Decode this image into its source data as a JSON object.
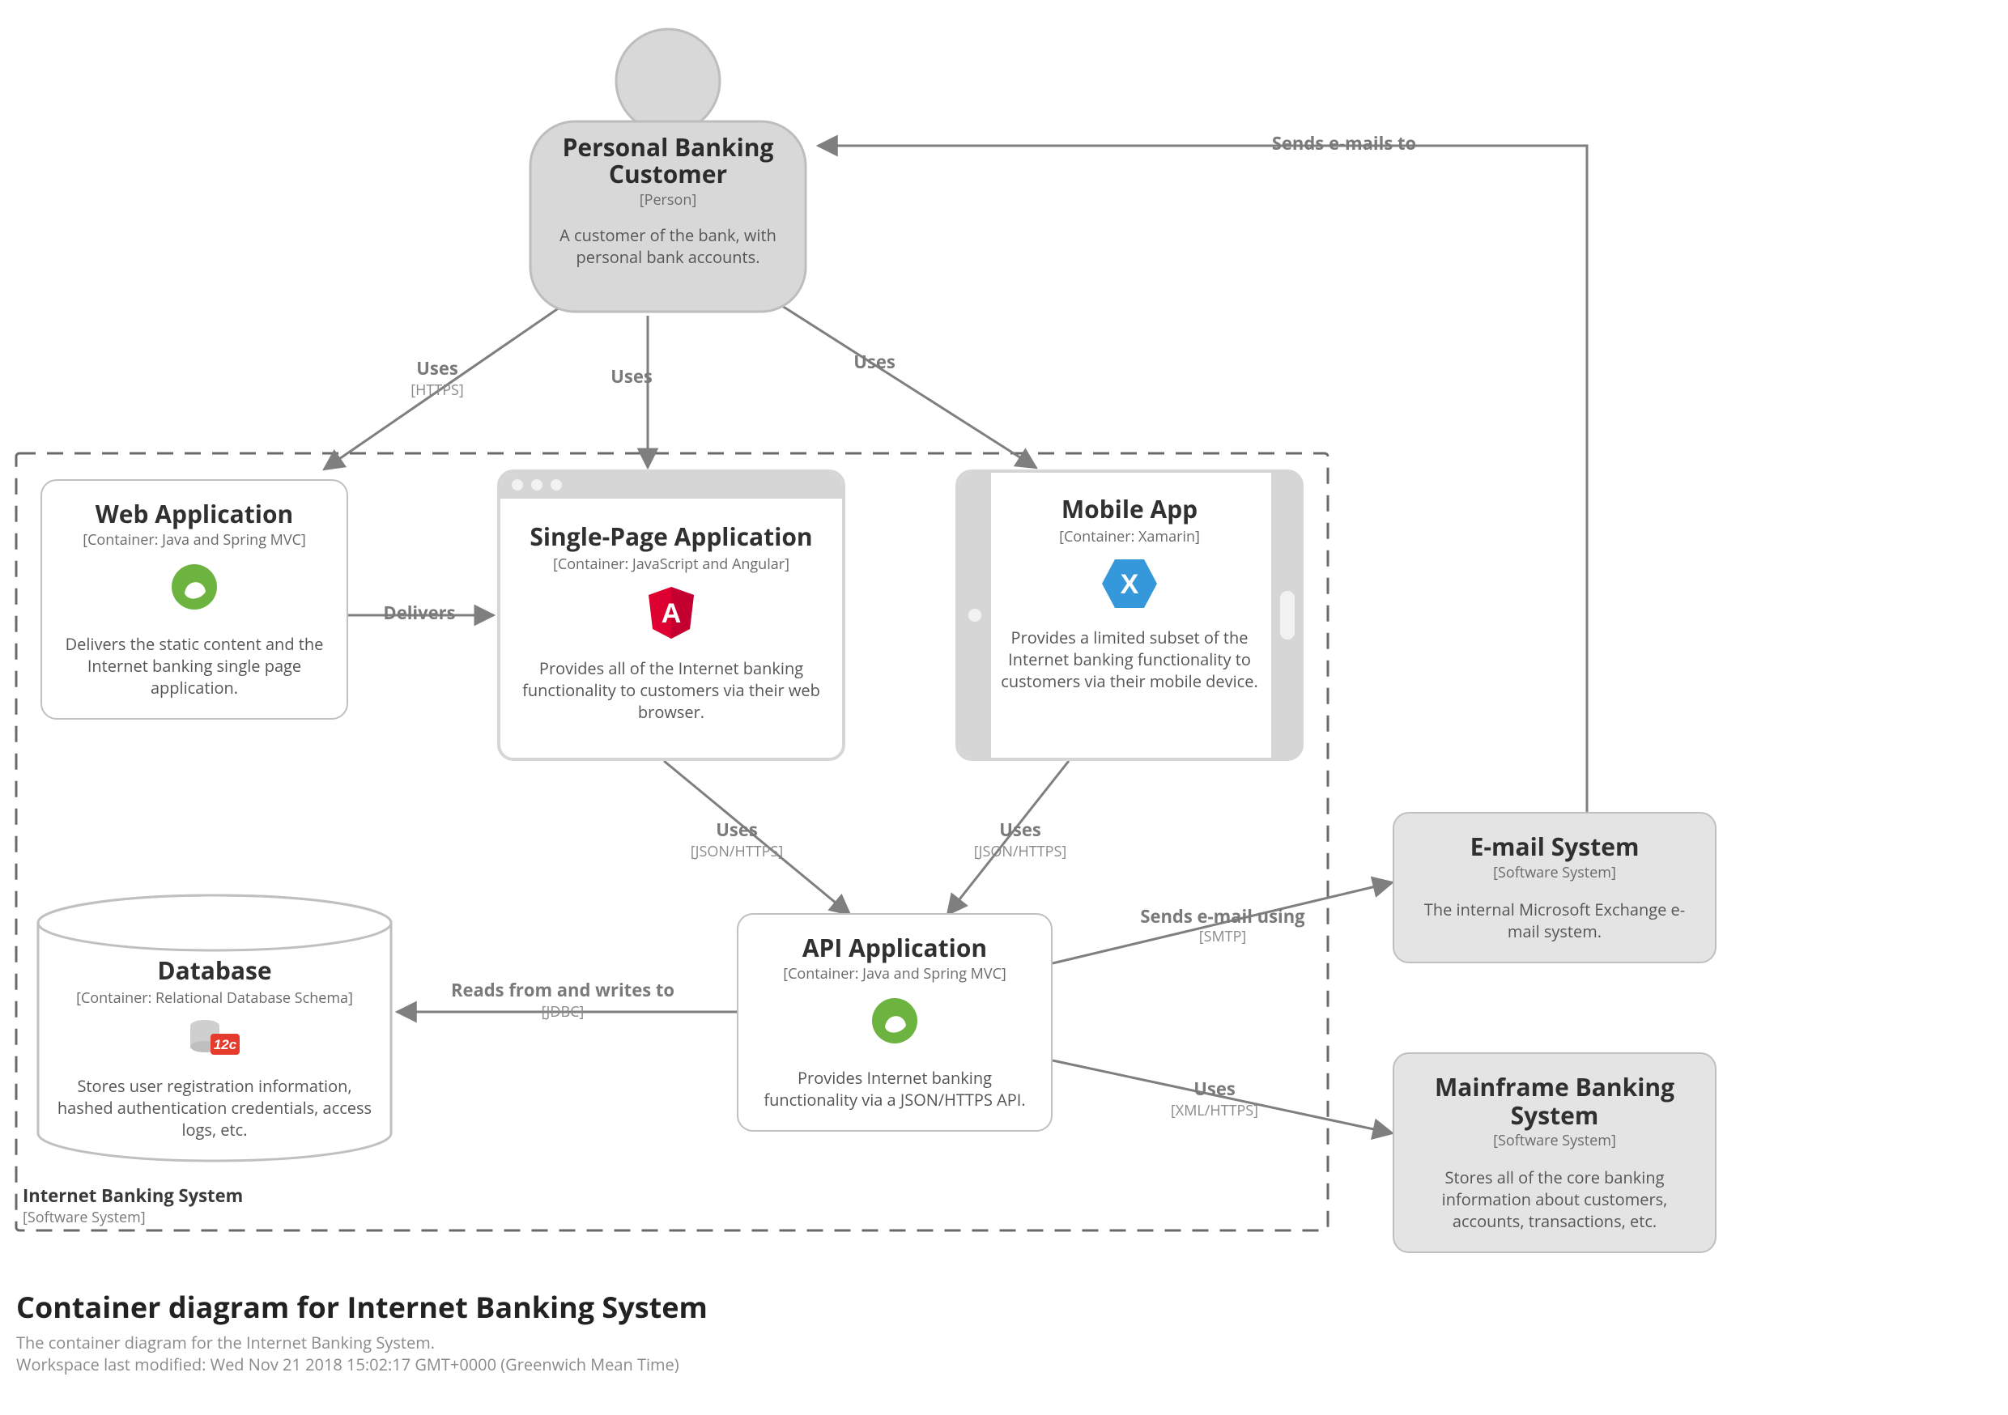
{
  "person": {
    "title": "Personal Banking Customer",
    "meta": "[Person]",
    "desc": "A customer of the bank, with personal bank accounts."
  },
  "boundary": {
    "title": "Internet Banking System",
    "meta": "[Software System]"
  },
  "containers": {
    "web": {
      "title": "Web Application",
      "meta": "[Container: Java and Spring MVC]",
      "desc": "Delivers the static content and the Internet banking single page application."
    },
    "spa": {
      "title": "Single-Page Application",
      "meta": "[Container: JavaScript and Angular]",
      "desc": "Provides all of the Internet banking functionality to customers via their web browser."
    },
    "mobile": {
      "title": "Mobile App",
      "meta": "[Container: Xamarin]",
      "desc": "Provides a limited subset of the Internet banking functionality to customers via their mobile device."
    },
    "api": {
      "title": "API Application",
      "meta": "[Container: Java and Spring MVC]",
      "desc": "Provides Internet banking functionality via a JSON/HTTPS API."
    },
    "db": {
      "title": "Database",
      "meta": "[Container: Relational Database Schema]",
      "desc": "Stores user registration information, hashed authentication credentials, access logs, etc."
    }
  },
  "externals": {
    "email": {
      "title": "E-mail System",
      "meta": "[Software System]",
      "desc": "The internal Microsoft Exchange e-mail system."
    },
    "mainframe": {
      "title": "Mainframe Banking System",
      "meta": "[Software System]",
      "desc": "Stores all of the core banking information about customers, accounts, transactions, etc."
    }
  },
  "edges": {
    "uses1": {
      "label": "Uses",
      "proto": "[HTTPS]"
    },
    "uses2": {
      "label": "Uses"
    },
    "uses3": {
      "label": "Uses"
    },
    "delivers": {
      "label": "Delivers"
    },
    "spa_api": {
      "label": "Uses",
      "proto": "[JSON/HTTPS]"
    },
    "mobile_api": {
      "label": "Uses",
      "proto": "[JSON/HTTPS]"
    },
    "api_db": {
      "label": "Reads from and writes to",
      "proto": "[JDBC]"
    },
    "api_email": {
      "label": "Sends e-mail using",
      "proto": "[SMTP]"
    },
    "api_mainframe": {
      "label": "Uses",
      "proto": "[XML/HTTPS]"
    },
    "email_person": {
      "label": "Sends e-mails to"
    }
  },
  "footer": {
    "title": "Container diagram for Internet Banking System",
    "line1": "The container diagram for the Internet Banking System.",
    "line2": "Workspace last modified: Wed Nov 21 2018 15:02:17 GMT+0000 (Greenwich Mean Time)"
  },
  "icons": {
    "spring": "spring-icon",
    "angular": "angular-icon",
    "xamarin": "xamarin-icon",
    "oracle": "oracle-icon"
  }
}
